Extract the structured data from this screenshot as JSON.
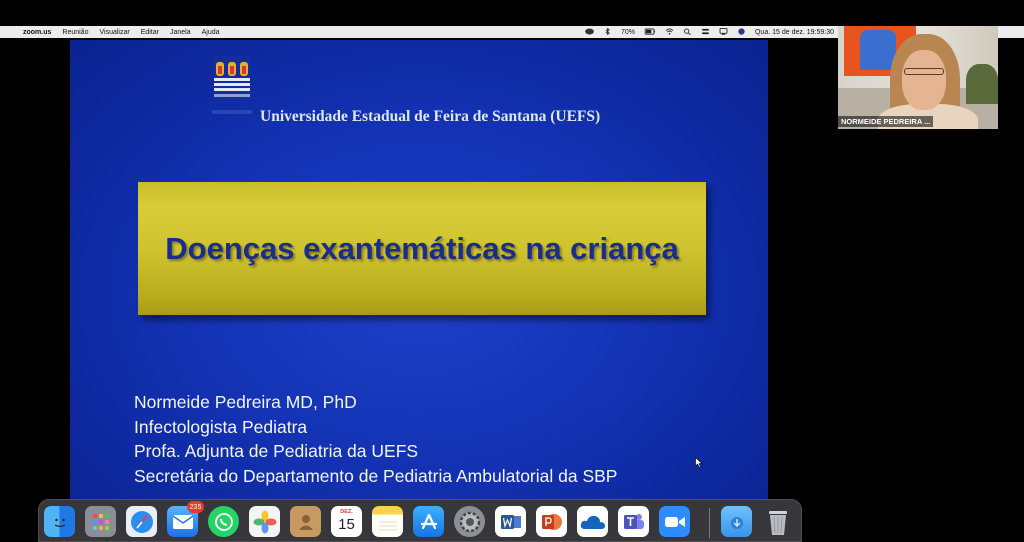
{
  "menubar": {
    "app_name": "zoom.us",
    "menus": [
      "Reunião",
      "Visualizar",
      "Editar",
      "Janela",
      "Ajuda"
    ],
    "battery": "70%",
    "datetime": "Qua. 15 de dez.  19:59:30"
  },
  "slide": {
    "university": "Universidade Estadual de Feira de Santana (UEFS)",
    "title": "Doenças exantemáticas na criança",
    "author_lines": [
      "Normeide Pedreira MD, PhD",
      "Infectologista Pediatra",
      "Profa. Adjunta de Pediatria da UEFS",
      "Secretária do Departamento de Pediatria Ambulatorial da SBP"
    ]
  },
  "participant": {
    "name": "NORMEIDE PEDREIRA ..."
  },
  "dock": {
    "mail_badge": "235",
    "calendar_month": "DEZ.",
    "calendar_day": "15",
    "apps": [
      "finder-icon",
      "launchpad-icon",
      "safari-icon",
      "mail-icon",
      "whatsapp-icon",
      "photos-icon",
      "contacts-icon",
      "calendar-icon",
      "notes-icon",
      "app-store-icon",
      "system-preferences-icon",
      "word-icon",
      "powerpoint-icon",
      "onedrive-icon",
      "teams-icon",
      "zoom-icon",
      "downloads-folder-icon",
      "trash-icon"
    ]
  }
}
